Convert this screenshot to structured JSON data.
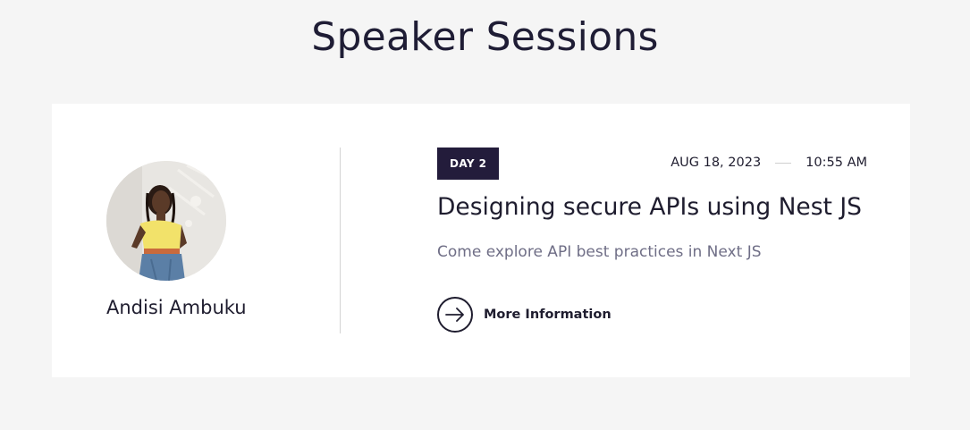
{
  "page": {
    "title": "Speaker Sessions"
  },
  "session": {
    "speaker_name": "Andisi Ambuku",
    "day_label": "DAY 2",
    "date": "AUG 18, 2023",
    "time": "10:55 AM",
    "title": "Designing secure APIs using Nest JS",
    "description": "Come explore API best practices in Next JS",
    "more_label": "More Information",
    "more_icon": "arrow-right-circle-icon"
  },
  "colors": {
    "background": "#f5f5f5",
    "card": "#ffffff",
    "badge": "#231c3b",
    "text_dark": "#1f1d2f",
    "text_muted": "#6f6e86"
  }
}
